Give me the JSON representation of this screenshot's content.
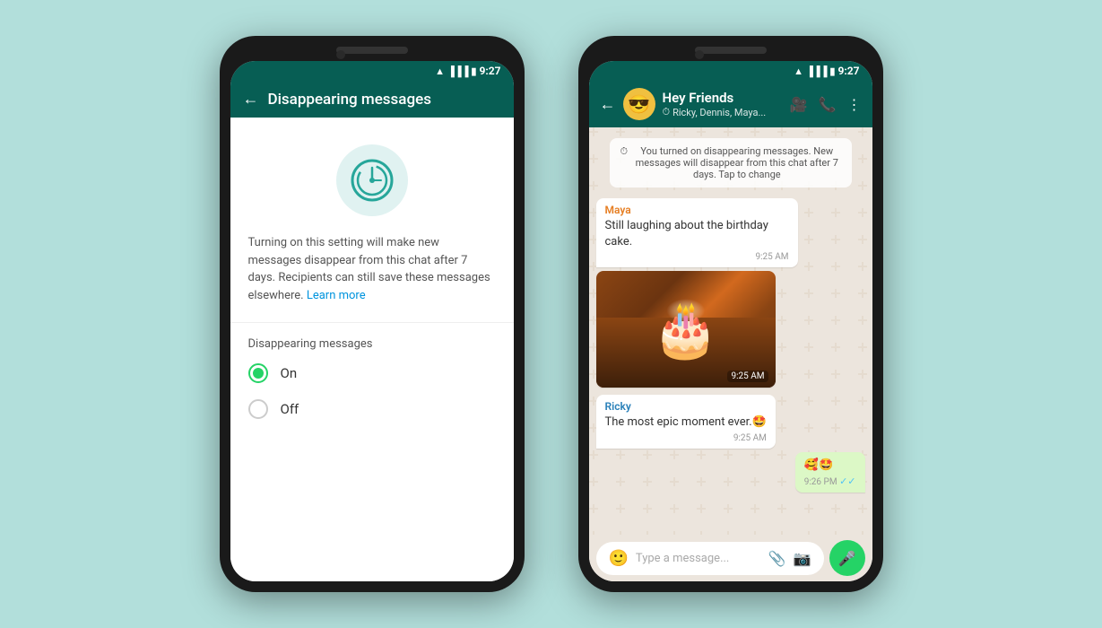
{
  "left_phone": {
    "status_bar": {
      "time": "9:27"
    },
    "header": {
      "title": "Disappearing messages",
      "back_label": "←"
    },
    "description": {
      "text": "Turning on this setting will make new messages disappear from this chat after 7 days. Recipients can still save these messages elsewhere.",
      "learn_more": "Learn more"
    },
    "settings": {
      "section_label": "Disappearing messages",
      "options": [
        {
          "label": "On",
          "selected": true
        },
        {
          "label": "Off",
          "selected": false
        }
      ]
    }
  },
  "right_phone": {
    "status_bar": {
      "time": "9:27"
    },
    "header": {
      "group_name": "Hey Friends",
      "members": "Ricky, Dennis, Maya...",
      "emoji": "😎"
    },
    "system_message": "You turned on disappearing messages. New messages will disappear from this chat after 7 days. Tap to change",
    "messages": [
      {
        "type": "incoming",
        "sender": "Maya",
        "sender_class": "maya",
        "text": "Still laughing about the birthday cake.",
        "time": "9:25 AM"
      },
      {
        "type": "image",
        "time": "9:25 AM"
      },
      {
        "type": "incoming",
        "sender": "Ricky",
        "sender_class": "ricky",
        "text": "The most epic moment ever.🤩",
        "time": "9:25 AM"
      },
      {
        "type": "outgoing",
        "text": "🥰🤩",
        "time": "9:26 PM",
        "checks": "✓✓"
      }
    ],
    "input": {
      "placeholder": "Type a message..."
    }
  }
}
